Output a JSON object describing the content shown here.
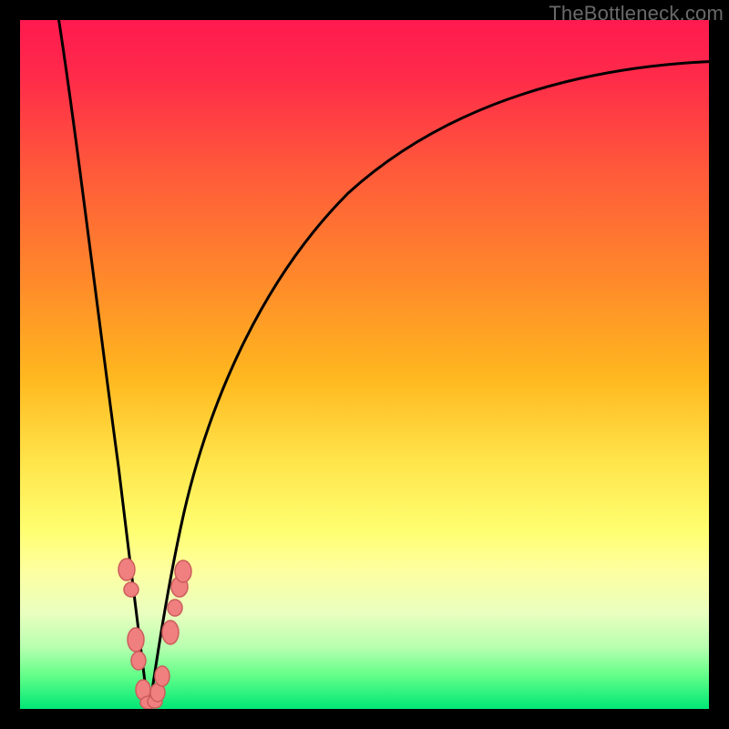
{
  "watermark": "TheBottleneck.com",
  "chart_data": {
    "type": "line",
    "title": "",
    "xlabel": "",
    "ylabel": "",
    "xlim": [
      0,
      100
    ],
    "ylim": [
      0,
      100
    ],
    "series": [
      {
        "name": "left-curve",
        "x": [
          5,
          7,
          9,
          11,
          13,
          14,
          15,
          16,
          17,
          18
        ],
        "y": [
          100,
          82,
          62,
          42,
          25,
          17,
          10,
          5,
          2,
          0
        ]
      },
      {
        "name": "right-curve",
        "x": [
          18,
          20,
          22,
          26,
          32,
          40,
          50,
          62,
          76,
          90,
          100
        ],
        "y": [
          0,
          10,
          22,
          38,
          54,
          66,
          75,
          82,
          88,
          92,
          94
        ]
      },
      {
        "name": "points-cluster",
        "x": [
          15.5,
          16.0,
          16.5,
          17.0,
          17.5,
          18.0,
          18.5,
          19.0,
          19.5,
          20.5,
          21.0,
          21.5,
          22.0
        ],
        "y": [
          20,
          18,
          10,
          8,
          3,
          1,
          1,
          2,
          4,
          10,
          14,
          17,
          19
        ]
      }
    ],
    "colors": {
      "curve": "#000000",
      "point_fill": "#f08080",
      "point_stroke": "#cc5c5c",
      "gradient_top": "#ff1a4f",
      "gradient_bottom": "#00e676"
    }
  }
}
